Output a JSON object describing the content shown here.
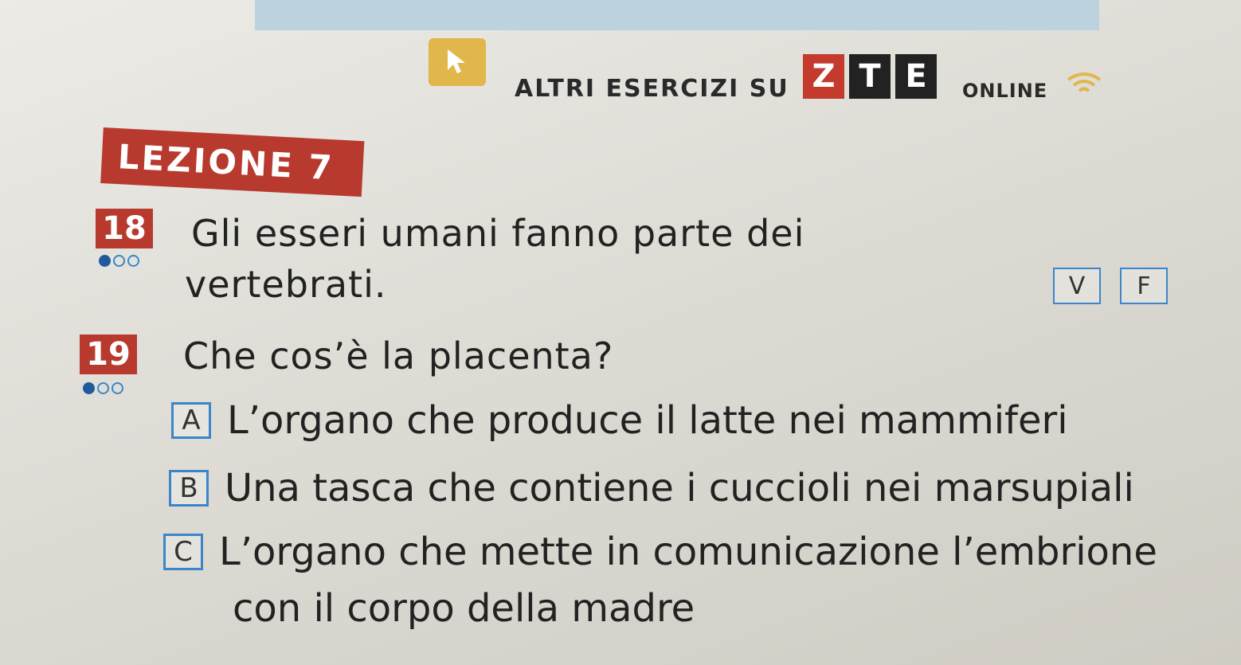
{
  "header": {
    "prefix": "ALTRI ESERCIZI SU",
    "logo_letters": [
      "Z",
      "T",
      "E"
    ],
    "suffix": "ONLINE",
    "icons": [
      "cursor-icon",
      "wifi-icon"
    ]
  },
  "lesson": {
    "label": "LEZIONE 7"
  },
  "questions": [
    {
      "number": "18",
      "difficulty": 1,
      "text_line1": "Gli esseri umani fanno parte dei",
      "text_line2": "vertebrati.",
      "true_label": "V",
      "false_label": "F"
    },
    {
      "number": "19",
      "difficulty": 1,
      "text": "Che cos’è la placenta?",
      "options": [
        {
          "letter": "A",
          "text": "L’organo che produce il latte nei mammiferi"
        },
        {
          "letter": "B",
          "text": "Una tasca che contiene i cuccioli nei marsupiali"
        },
        {
          "letter": "C",
          "text": "L’organo che mette in comunicazione l’embrione",
          "text_cont": "con il corpo della madre"
        }
      ]
    }
  ],
  "colors": {
    "accent_red": "#b83a2f",
    "accent_blue": "#3a86c9",
    "cursor_yellow": "#e1b64a"
  }
}
